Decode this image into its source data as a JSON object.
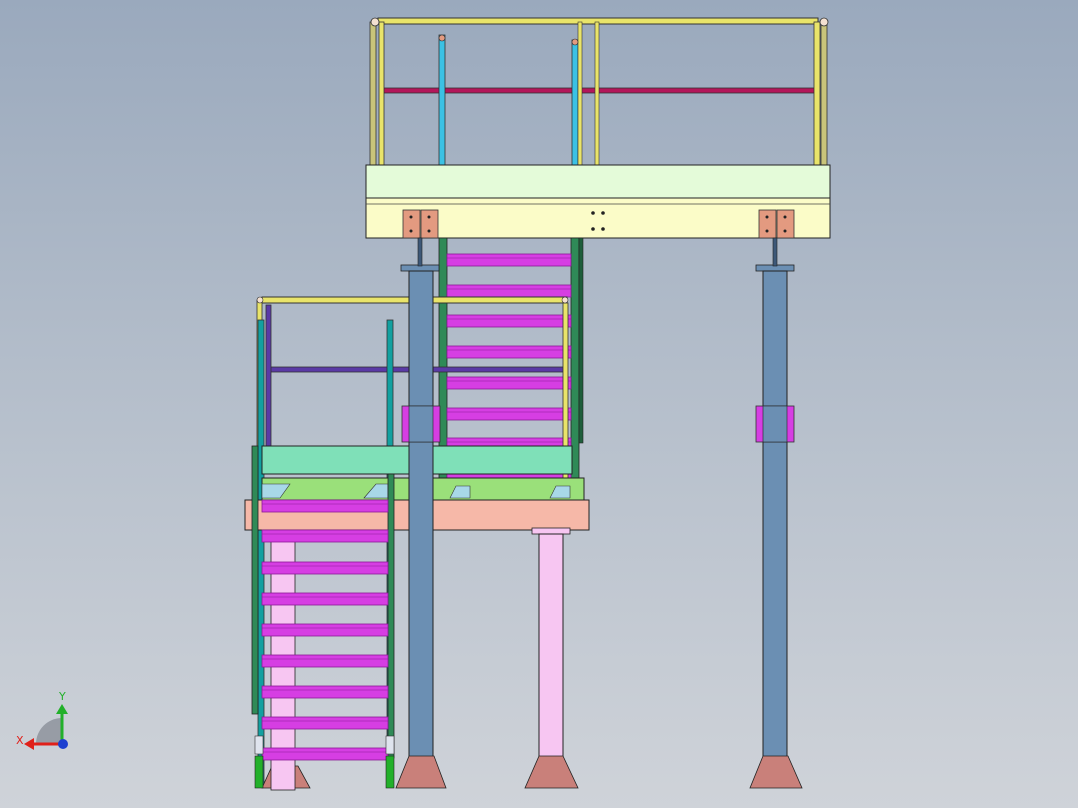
{
  "view": {
    "background_top": "#9aa9bd",
    "background_bottom": "#cfd3d9"
  },
  "triad": {
    "x_label": "X",
    "y_label": "Y",
    "x_color": "#e0201a",
    "y_color": "#22b02a",
    "z_color": "#1c3fd0"
  },
  "colors": {
    "column_blue": "#6b8fb3",
    "column_pink": "#f7c6f2",
    "base_plate": "#c9807a",
    "tread": "#d63ee3",
    "tread_edge": "#8a1a96",
    "upper_deck_top": "#e4fbd9",
    "upper_deck_beam": "#fbfcc8",
    "lower_deck_beam": "#f6b8a8",
    "lower_deck_top": "#7fe0b8",
    "stringer_green": "#2f8a57",
    "rail_yellow": "#e9e46a",
    "rail_magenta": "#b3165a",
    "rail_cyan": "#3bc1e4",
    "rail_purple": "#5a3aa6",
    "rail_teal": "#12a0a0",
    "connector": "#e39a80"
  }
}
